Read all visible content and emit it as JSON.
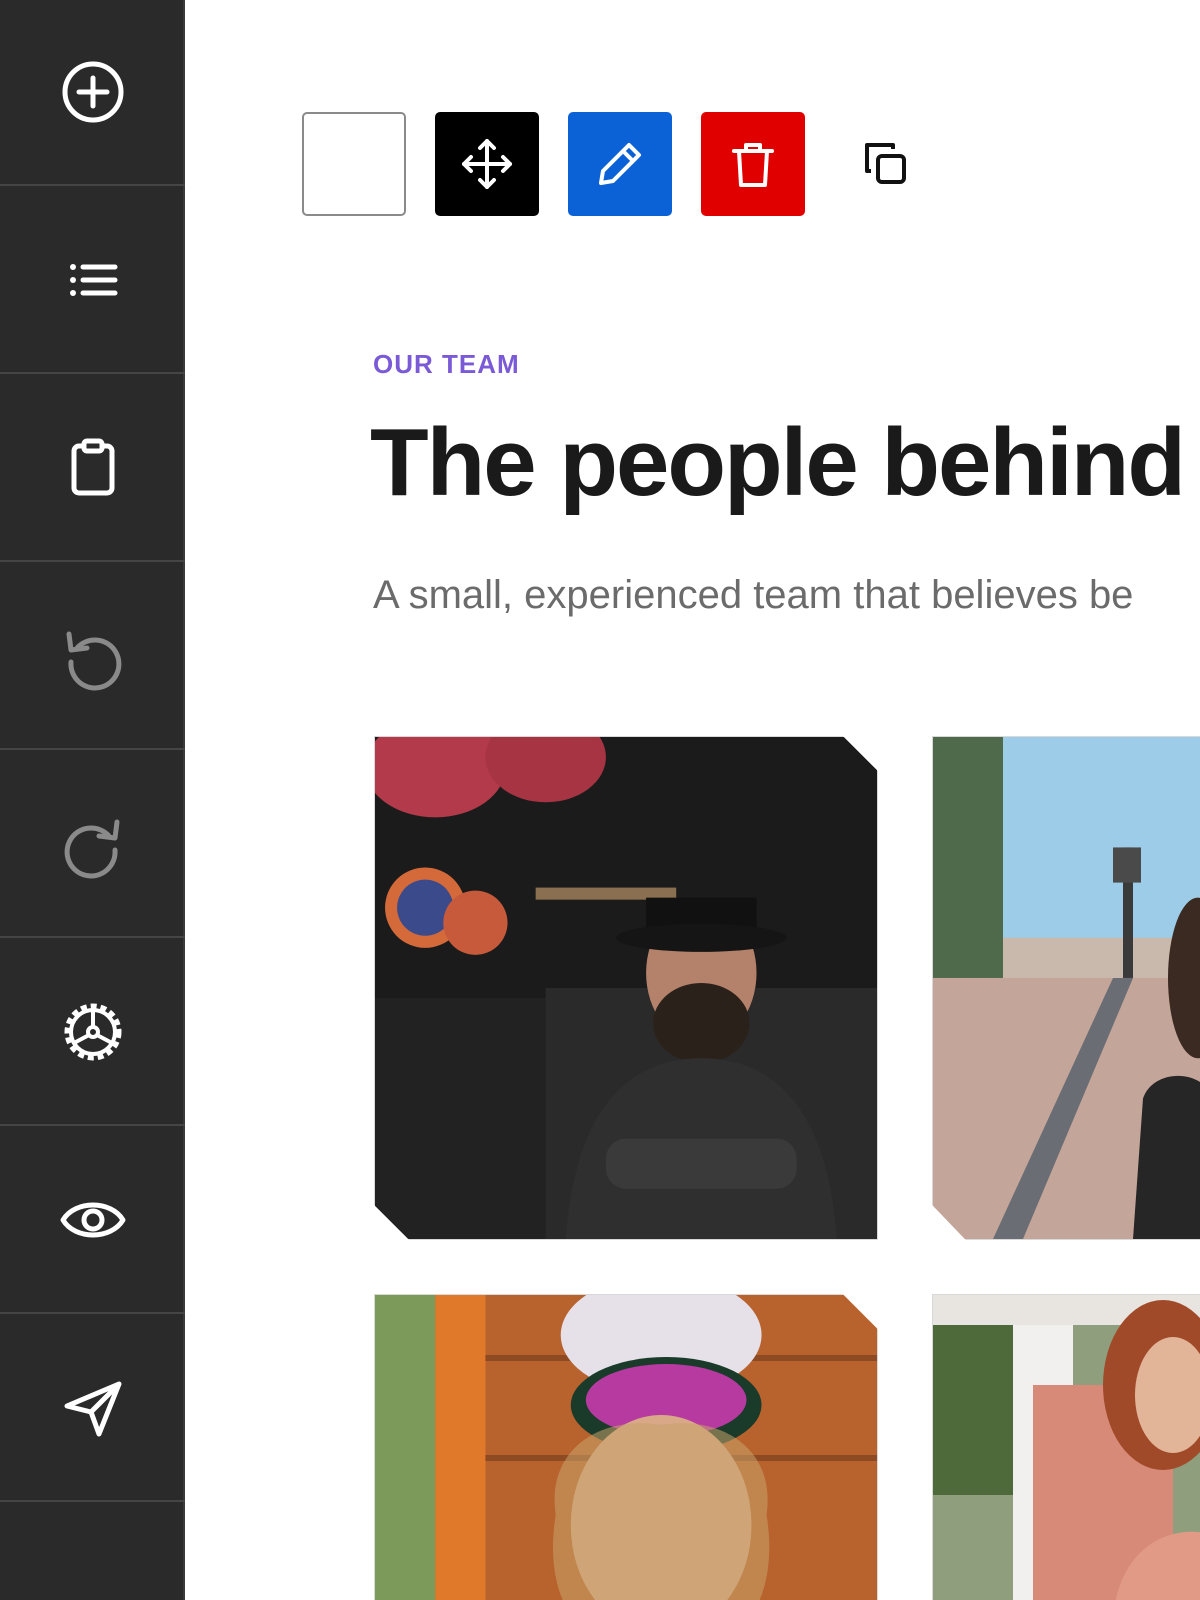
{
  "sidebar": {
    "items": [
      {
        "icon": "plus-circle-icon",
        "enabled": true
      },
      {
        "icon": "list-icon",
        "enabled": true
      },
      {
        "icon": "clipboard-icon",
        "enabled": true
      },
      {
        "icon": "undo-icon",
        "enabled": false
      },
      {
        "icon": "redo-icon",
        "enabled": false
      },
      {
        "icon": "settings-icon",
        "enabled": true
      },
      {
        "icon": "eye-icon",
        "enabled": true
      },
      {
        "icon": "send-icon",
        "enabled": true
      }
    ]
  },
  "toolbar": {
    "buttons": [
      {
        "icon": "blank-square-icon",
        "color": "#ffffff"
      },
      {
        "icon": "move-icon",
        "color": "#000000"
      },
      {
        "icon": "pencil-icon",
        "color": "#0b62d6"
      },
      {
        "icon": "trash-icon",
        "color": "#e00000"
      },
      {
        "icon": "duplicate-icon",
        "color": "transparent"
      }
    ]
  },
  "section": {
    "eyebrow": "OUR TEAM",
    "title": "The people behind",
    "subtitle": "A small, experienced team that believes be"
  },
  "team": {
    "photos": [
      {
        "name": "team-photo-1"
      },
      {
        "name": "team-photo-2"
      },
      {
        "name": "team-photo-3"
      },
      {
        "name": "team-photo-4"
      }
    ]
  },
  "colors": {
    "sidebar_bg": "#2a2a2a",
    "accent": "#7a5ad6",
    "edit_blue": "#0b62d6",
    "delete_red": "#e00000"
  }
}
